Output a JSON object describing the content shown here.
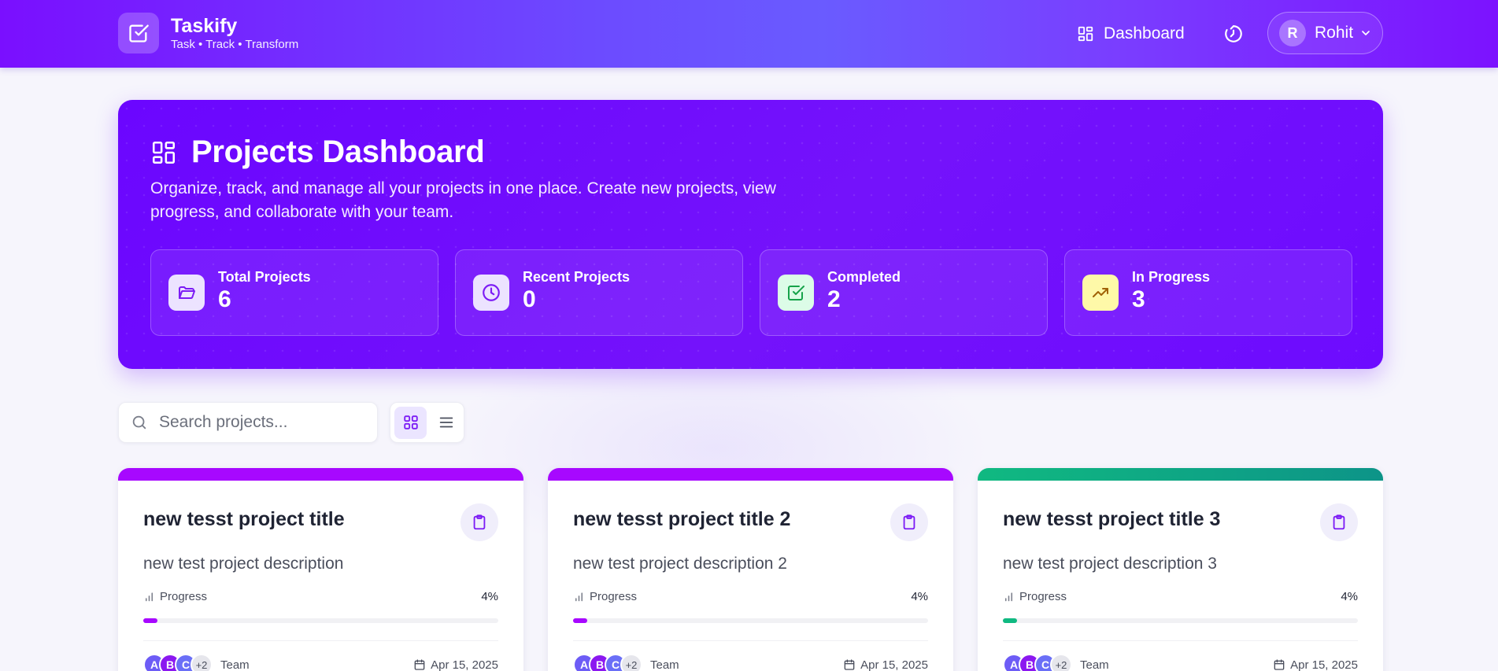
{
  "brand": {
    "name": "Taskify",
    "tagline": "Task • Track • Transform"
  },
  "nav": {
    "dashboard_label": "Dashboard",
    "user_initial": "R",
    "user_name": "Rohit"
  },
  "hero": {
    "title": "Projects Dashboard",
    "description": "Organize, track, and manage all your projects in one place. Create new projects, view progress, and collaborate with your team.",
    "stats": [
      {
        "label": "Total Projects",
        "value": "6",
        "icon": "folder-icon"
      },
      {
        "label": "Recent Projects",
        "value": "0",
        "icon": "clock-icon"
      },
      {
        "label": "Completed",
        "value": "2",
        "icon": "check-square-icon"
      },
      {
        "label": "In Progress",
        "value": "3",
        "icon": "trending-up-icon"
      }
    ]
  },
  "toolbar": {
    "search_placeholder": "Search projects...",
    "search_value": ""
  },
  "projects": [
    {
      "title": "new tesst project title",
      "description": "new test project description",
      "progress_label": "Progress",
      "progress": 4,
      "progress_text": "4%",
      "avatars": [
        "A",
        "B",
        "C"
      ],
      "more": "+2",
      "team_label": "Team",
      "date": "Apr 15, 2025",
      "accent": "#a708ff"
    },
    {
      "title": "new tesst project title 2",
      "description": "new test project description 2",
      "progress_label": "Progress",
      "progress": 4,
      "progress_text": "4%",
      "avatars": [
        "A",
        "B",
        "C"
      ],
      "more": "+2",
      "team_label": "Team",
      "date": "Apr 15, 2025",
      "accent": "#a708ff"
    },
    {
      "title": "new tesst project title 3",
      "description": "new test project description 3",
      "progress_label": "Progress",
      "progress": 4,
      "progress_text": "4%",
      "avatars": [
        "A",
        "B",
        "C"
      ],
      "more": "+2",
      "team_label": "Team",
      "date": "Apr 15, 2025",
      "accent": "#10b981"
    }
  ],
  "colors": {
    "header_start": "#7a0fff",
    "hero": "#6d0bff",
    "purple_accent": "#a708ff",
    "green_accent": "#10b981",
    "icon_purple": "#7c1cf5"
  }
}
